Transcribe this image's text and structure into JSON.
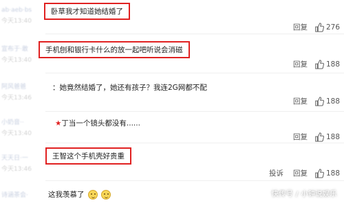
{
  "comments": [
    {
      "username": "ab·aeb·bs",
      "time": "今天13:40",
      "text": "卧草我才知道她结婚了",
      "actions": [
        "回复"
      ],
      "likes": "276"
    },
    {
      "username": "宣布于·敢",
      "time": "今天13:40",
      "text": "手机刨和银行卡什么的放一起吧听说会消磁",
      "actions": [
        "回复"
      ],
      "likes": "188"
    },
    {
      "username": "阿风爸爸",
      "time": "今天13:46",
      "text": "：她竟然结婚了，她还有孩子？我连2G网都不配",
      "actions": [
        "回复"
      ],
      "likes": "188"
    },
    {
      "username": "小奶音··",
      "time": "今天13:40",
      "text": "丁当一个镜头都没有......",
      "actions": [
        "回复"
      ],
      "likes": "188"
    },
    {
      "username": "天天日·一",
      "time": "今天13:46",
      "text": "王智这个手机壳好贵重",
      "actions": [
        "投诉",
        "回复"
      ],
      "likes": "188"
    },
    {
      "username": "诗涵茶会·",
      "time": "",
      "text": "这我羡慕了",
      "actions": [],
      "likes": ""
    }
  ],
  "star_glyph": "★",
  "watermark": "快传号 / 小钟说娱乐",
  "colors": {
    "highlight": "#e02020",
    "username": "#c7cfe0"
  }
}
